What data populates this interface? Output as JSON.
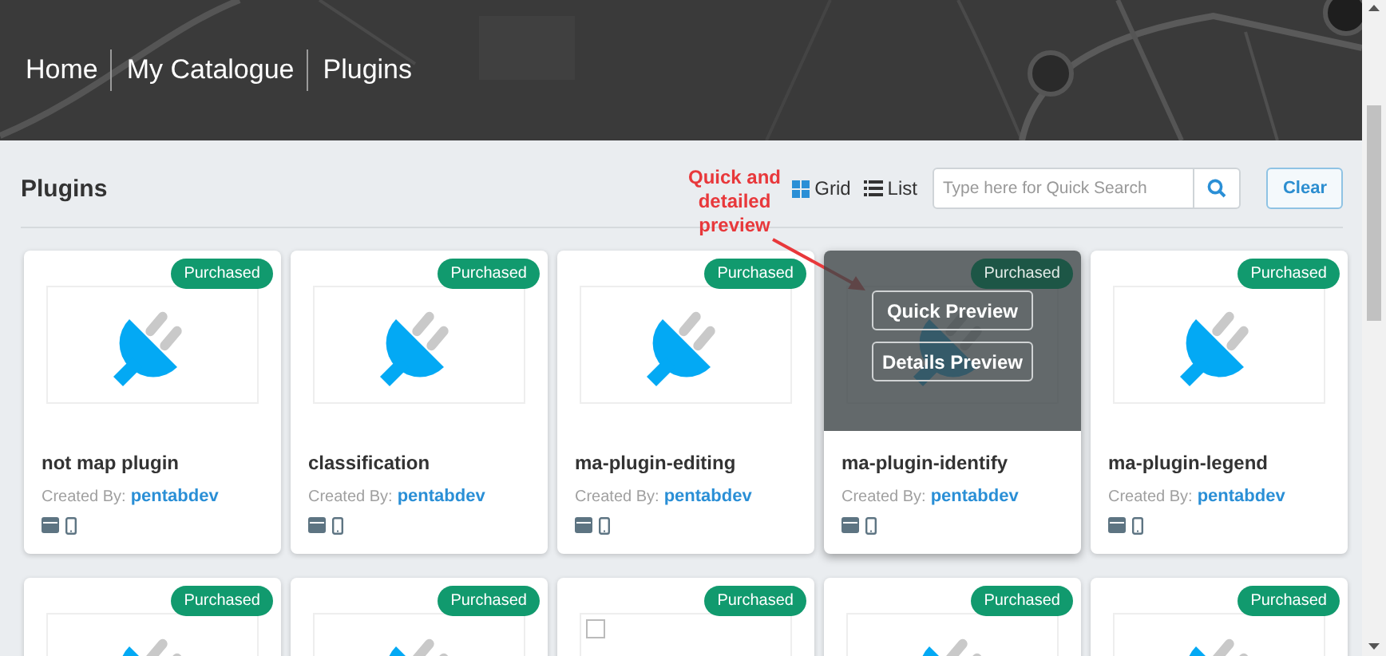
{
  "breadcrumb": [
    "Home",
    "My Catalogue",
    "Plugins"
  ],
  "page_title": "Plugins",
  "view_toggle": [
    {
      "label": "Grid",
      "kind": "grid",
      "selected": true
    },
    {
      "label": "List",
      "kind": "list",
      "selected": false
    }
  ],
  "search": {
    "placeholder": "Type here for Quick Search"
  },
  "clear_button": "Clear",
  "annotation": {
    "text": "Quick and detailed preview"
  },
  "plugins": [
    {
      "kind": "plugin",
      "badge": "Purchased",
      "name": "not map plugin",
      "created_by": "Created By:",
      "author": "pentabdev",
      "hovered": false
    },
    {
      "kind": "plugin",
      "badge": "Purchased",
      "name": "classification",
      "created_by": "Created By:",
      "author": "pentabdev",
      "hovered": false
    },
    {
      "kind": "plugin",
      "badge": "Purchased",
      "name": "ma-plugin-editing",
      "created_by": "Created By:",
      "author": "pentabdev",
      "hovered": false
    },
    {
      "kind": "plugin",
      "badge": "Purchased",
      "name": "ma-plugin-identify",
      "created_by": "Created By:",
      "author": "pentabdev",
      "hovered": true,
      "preview_buttons": [
        "Quick Preview",
        "Details Preview"
      ]
    },
    {
      "kind": "plugin",
      "badge": "Purchased",
      "name": "ma-plugin-legend",
      "created_by": "Created By:",
      "author": "pentabdev",
      "hovered": false
    },
    {
      "kind": "plugin",
      "badge": "Purchased",
      "hovered": false
    },
    {
      "kind": "plugin",
      "badge": "Purchased",
      "hovered": false
    },
    {
      "kind": "broken",
      "badge": "Purchased",
      "hovered": false
    },
    {
      "kind": "plugin",
      "badge": "Purchased",
      "hovered": false
    },
    {
      "kind": "plugin",
      "badge": "Purchased",
      "hovered": false
    }
  ]
}
